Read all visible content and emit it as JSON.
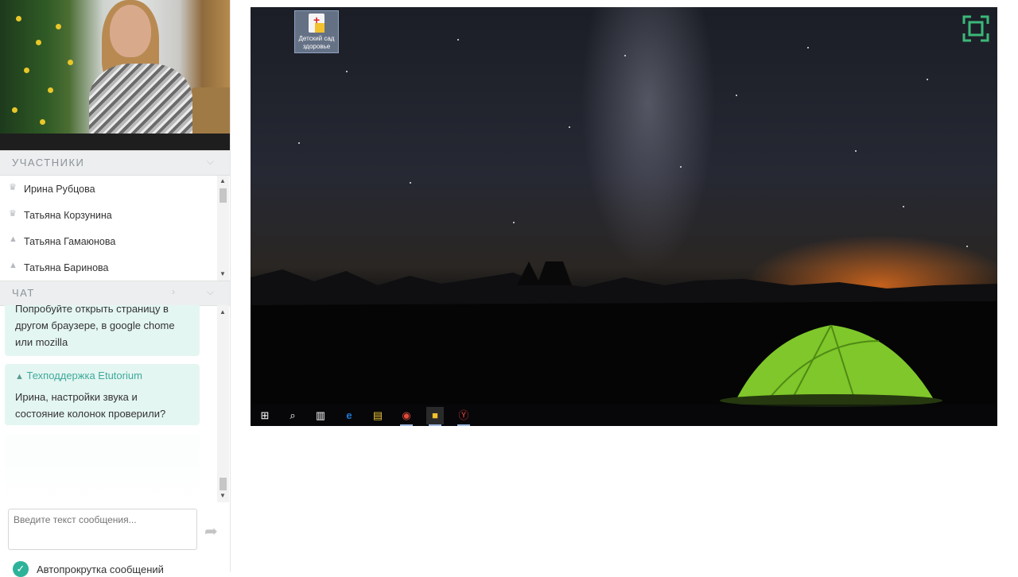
{
  "participants_panel": {
    "title": "УЧАСТНИКИ",
    "items": [
      {
        "name": "Ирина Рубцова",
        "icon": "crown-icon"
      },
      {
        "name": "Татьяна Корзунина",
        "icon": "crown-icon"
      },
      {
        "name": "Татьяна Гамаюнова",
        "icon": "graduation-cap-icon"
      },
      {
        "name": "Татьяна Баринова",
        "icon": "graduation-cap-icon"
      }
    ]
  },
  "chat_panel": {
    "title": "ЧАТ",
    "messages": [
      {
        "author": "",
        "text_lines": [
          "Попробуйте открыть страницу в",
          "другом браузере, в google chome",
          "или mozilla"
        ]
      },
      {
        "author": "Техподдержка Etutorium",
        "text_lines": [
          "Ирина, настройки звука и",
          "состояние колонок проверили?"
        ]
      }
    ],
    "input_placeholder": "Введите текст сообщения...",
    "autoscroll_label": "Автопрокрутка сообщений"
  },
  "screen_share": {
    "desktop_icon_label": "Детский сад здоровье",
    "taskbar_items": [
      "windows-start-icon",
      "search-icon",
      "task-view-icon",
      "edge-icon",
      "file-explorer-icon",
      "chrome-icon",
      "kindergarten-app-icon",
      "yandex-browser-icon"
    ],
    "accent_color": "#3cb879"
  }
}
